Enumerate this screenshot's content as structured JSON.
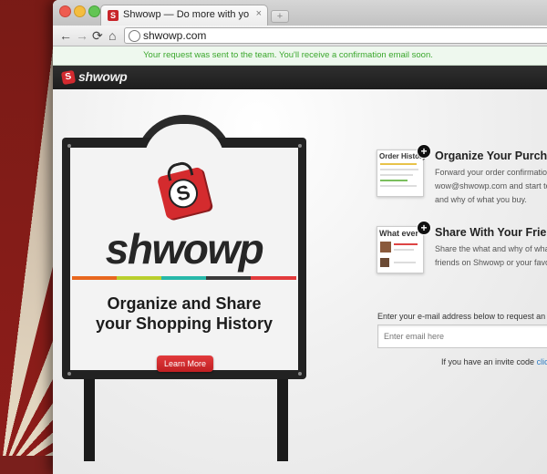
{
  "browser": {
    "tab_title": "Shwowp — Do more with yo",
    "tab_close": "×",
    "new_tab": "+",
    "favicon_letter": "S",
    "url": "shwowp.com",
    "back": "←",
    "forward": "→",
    "reload": "⟳",
    "home": "⌂"
  },
  "notice": {
    "text": "Your request was sent to the team. You'll receive a confirmation email soon.",
    "color": "#3aa72c"
  },
  "site": {
    "logo_letter": "S",
    "logo_text": "shwowp"
  },
  "sign": {
    "bag_letter": "S",
    "brand": "shwowp",
    "headline_line1": "Organize and Share",
    "headline_line2": "your Shopping History",
    "button_label": "Learn More",
    "stripe_colors": [
      "#e8671f",
      "#b9cf2d",
      "#27b8a9",
      "#3a3a3a",
      "#e23a3c"
    ]
  },
  "features": [
    {
      "thumb_title": "Order History",
      "title": "Organize Your Purchas",
      "desc": [
        "Forward your order confirmation",
        "wow@shwowp.com and start to",
        "and why of what you buy."
      ]
    },
    {
      "thumb_title": "What ever",
      "title": "Share With Your Friend",
      "desc": [
        "Share the what and why of what",
        "friends on Shwowp or your favo"
      ]
    }
  ],
  "invite": {
    "label": "Enter your e-mail address below to request an i",
    "placeholder": "Enter email here",
    "code_text": "If you have an invite code ",
    "code_link": "clic"
  }
}
